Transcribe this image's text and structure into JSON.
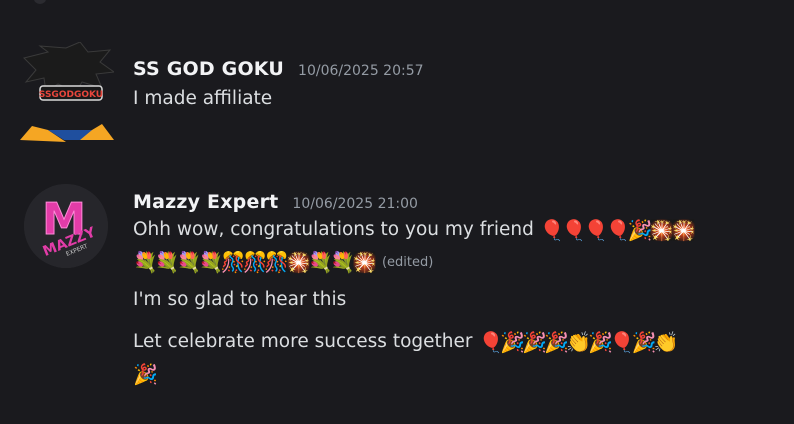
{
  "messages": [
    {
      "author": "SS GOD GOKU",
      "timestamp": "10/06/2025 20:57",
      "lines": [
        "I made affiliate"
      ],
      "avatar_text": "SSGODGOKU"
    },
    {
      "author": "Mazzy Expert",
      "timestamp": "10/06/2025 21:00",
      "line1_text": "Ohh wow, congratulations to you my friend",
      "line1_emojis": "🎈🎈🎈🎈🎉🎇🎇",
      "line2_emojis": "💐💐💐💐🎊🎊🎊🎇💐💐🎇",
      "edited_label": "(edited)",
      "line3_text": "I'm so glad to hear this",
      "line4_text": "Let celebrate more success together",
      "line4_emojis": "🎈🎉🎉🎉👏🎉🎈🎉👏",
      "line5_emojis": "🎉",
      "avatar_letter": "M",
      "avatar_text": "MAZZY",
      "avatar_subtext": "EXPERT"
    }
  ],
  "colors": {
    "background": "#1a1a1e",
    "name": "#f2f3f5",
    "timestamp": "#949ba4",
    "text": "#dbdee1",
    "mazzy_accent": "#e23ca8"
  }
}
